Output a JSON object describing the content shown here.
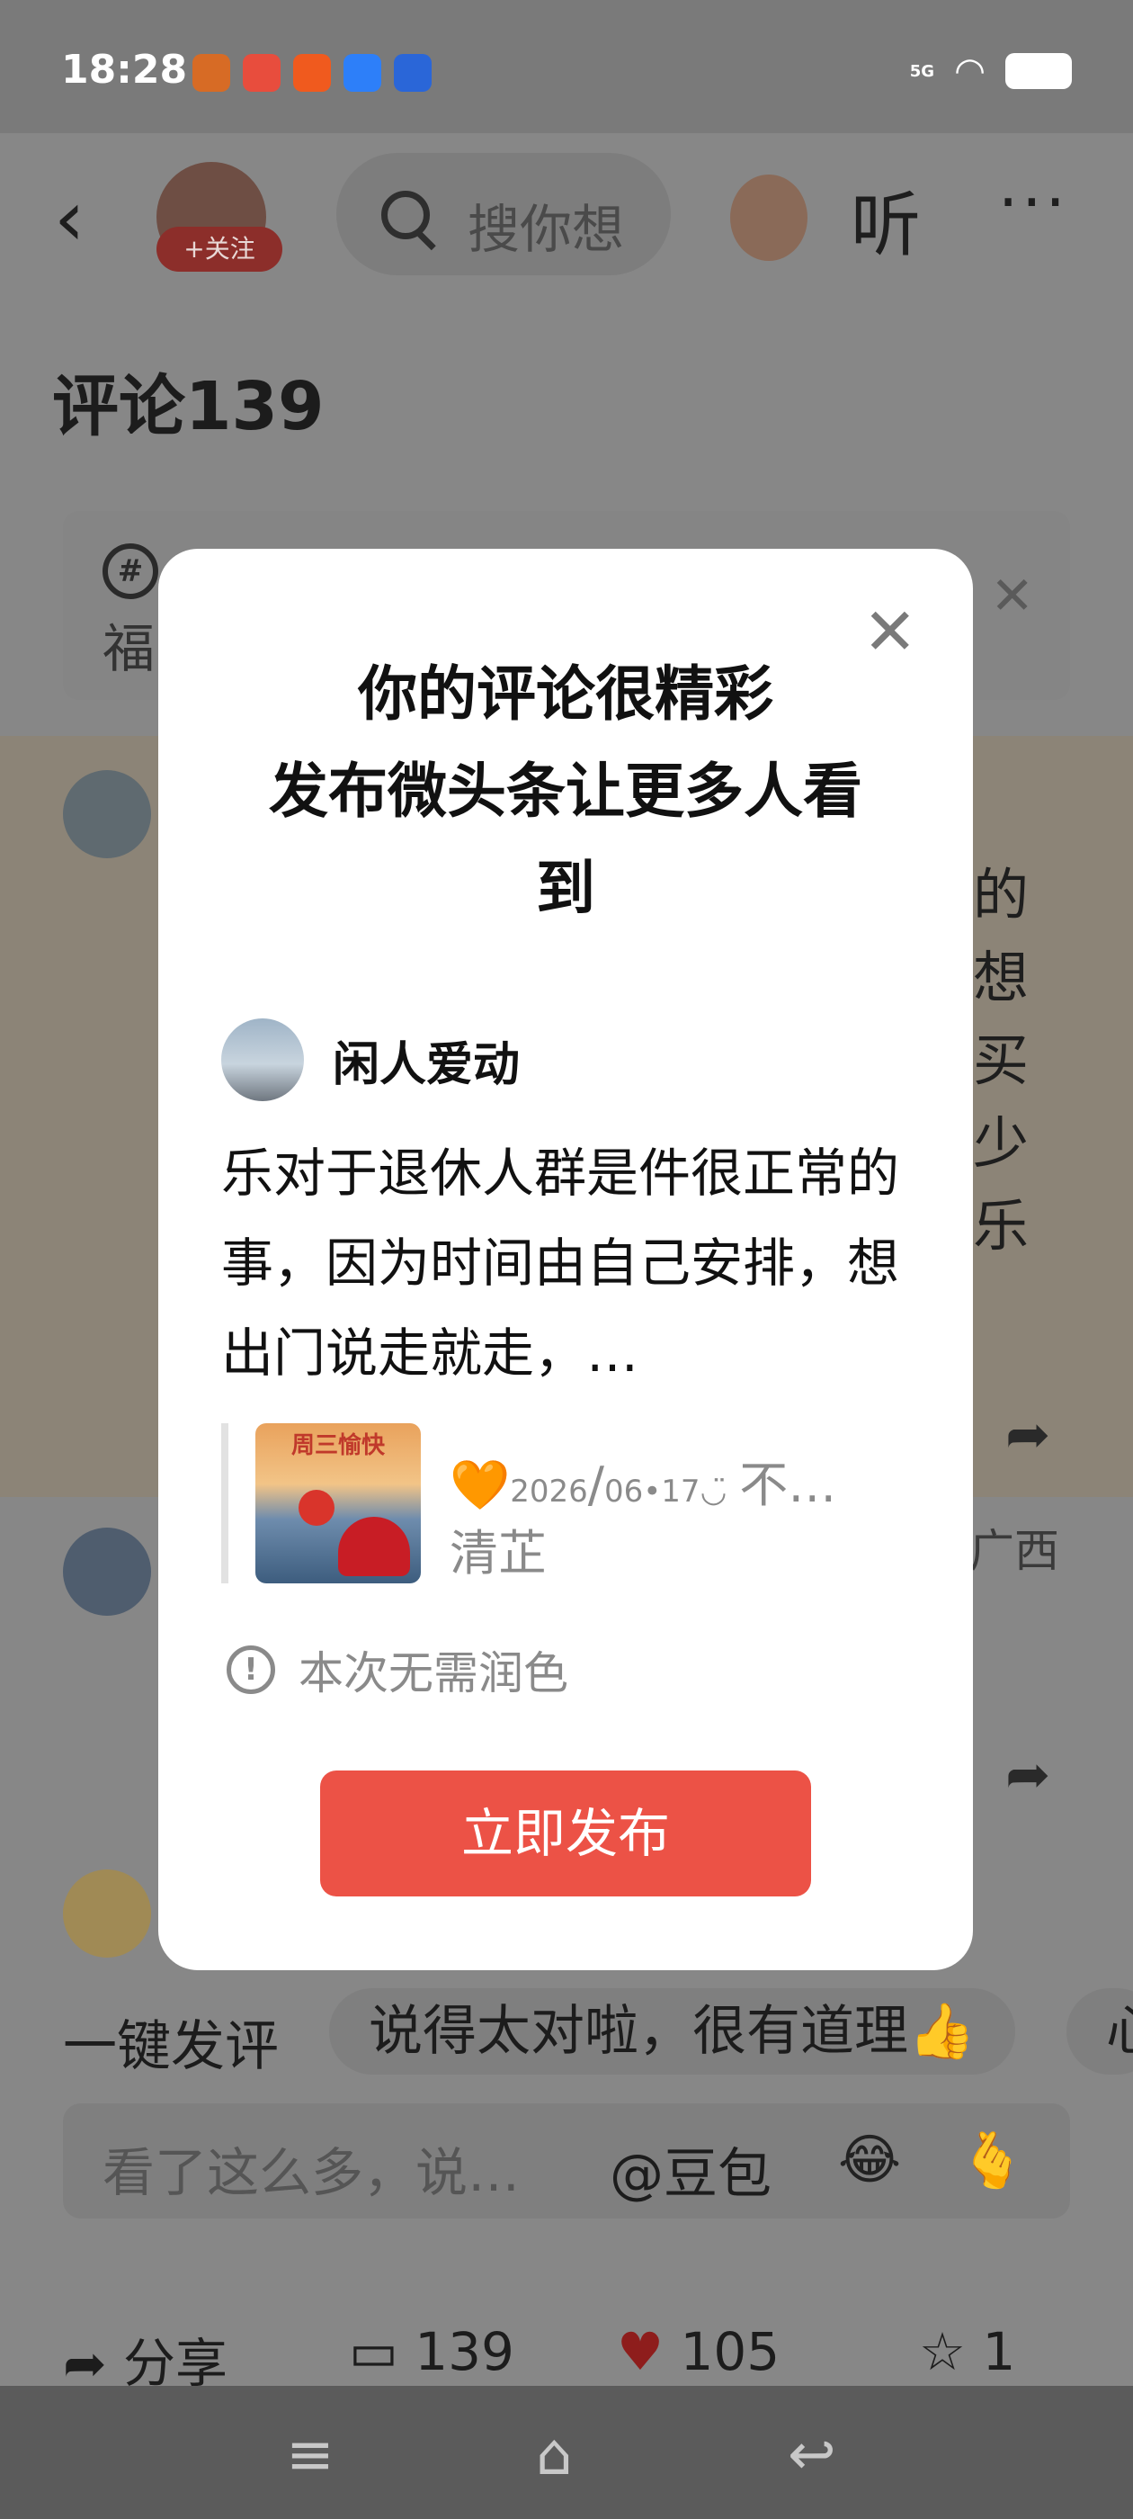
{
  "status_bar": {
    "time": "18:28",
    "network": "5G",
    "app_icon_colors": [
      "#d76b25",
      "#e84d3d",
      "#f05a1e",
      "#2d7ff9",
      "#2a66d8"
    ]
  },
  "header": {
    "follow_label": "+关注",
    "search_placeholder": "搜你想",
    "listen_label": "听",
    "more_label": "···"
  },
  "comments": {
    "title": "评论139",
    "topic_prefix": "福",
    "side_chars": [
      "的",
      "想",
      "买",
      "少",
      "乐"
    ],
    "region": "广西"
  },
  "quick_replies": {
    "label": "一键发评",
    "options": [
      "说得太对啦，很有道理👍",
      "心"
    ]
  },
  "comment_input": {
    "placeholder": "看了这么多，说…",
    "mention": "@豆包",
    "emojis": [
      "😂",
      "🫰"
    ]
  },
  "actions": {
    "share_label": "分享",
    "comment_count": "139",
    "like_count": "105",
    "favorite_count": "1"
  },
  "modal": {
    "title_lines": [
      "你的评论很精彩",
      "发布微头条让更多人看",
      "到"
    ],
    "author": "闲人爱动",
    "body": "乐对于退休人群是件很正常的事，因为时间由自己安排，想出门说走就走，…",
    "quote": {
      "thumb_title": "周三愉快",
      "emoji": "🧡",
      "year": "2026",
      "date": "06•17",
      "tail": "不…",
      "author": "清芷"
    },
    "hint": "本次无需润色",
    "publish_label": "立即发布"
  },
  "colors": {
    "accent": "#ec5246",
    "overlay": "#8d8d8d",
    "heart": "#8e1d1c"
  }
}
